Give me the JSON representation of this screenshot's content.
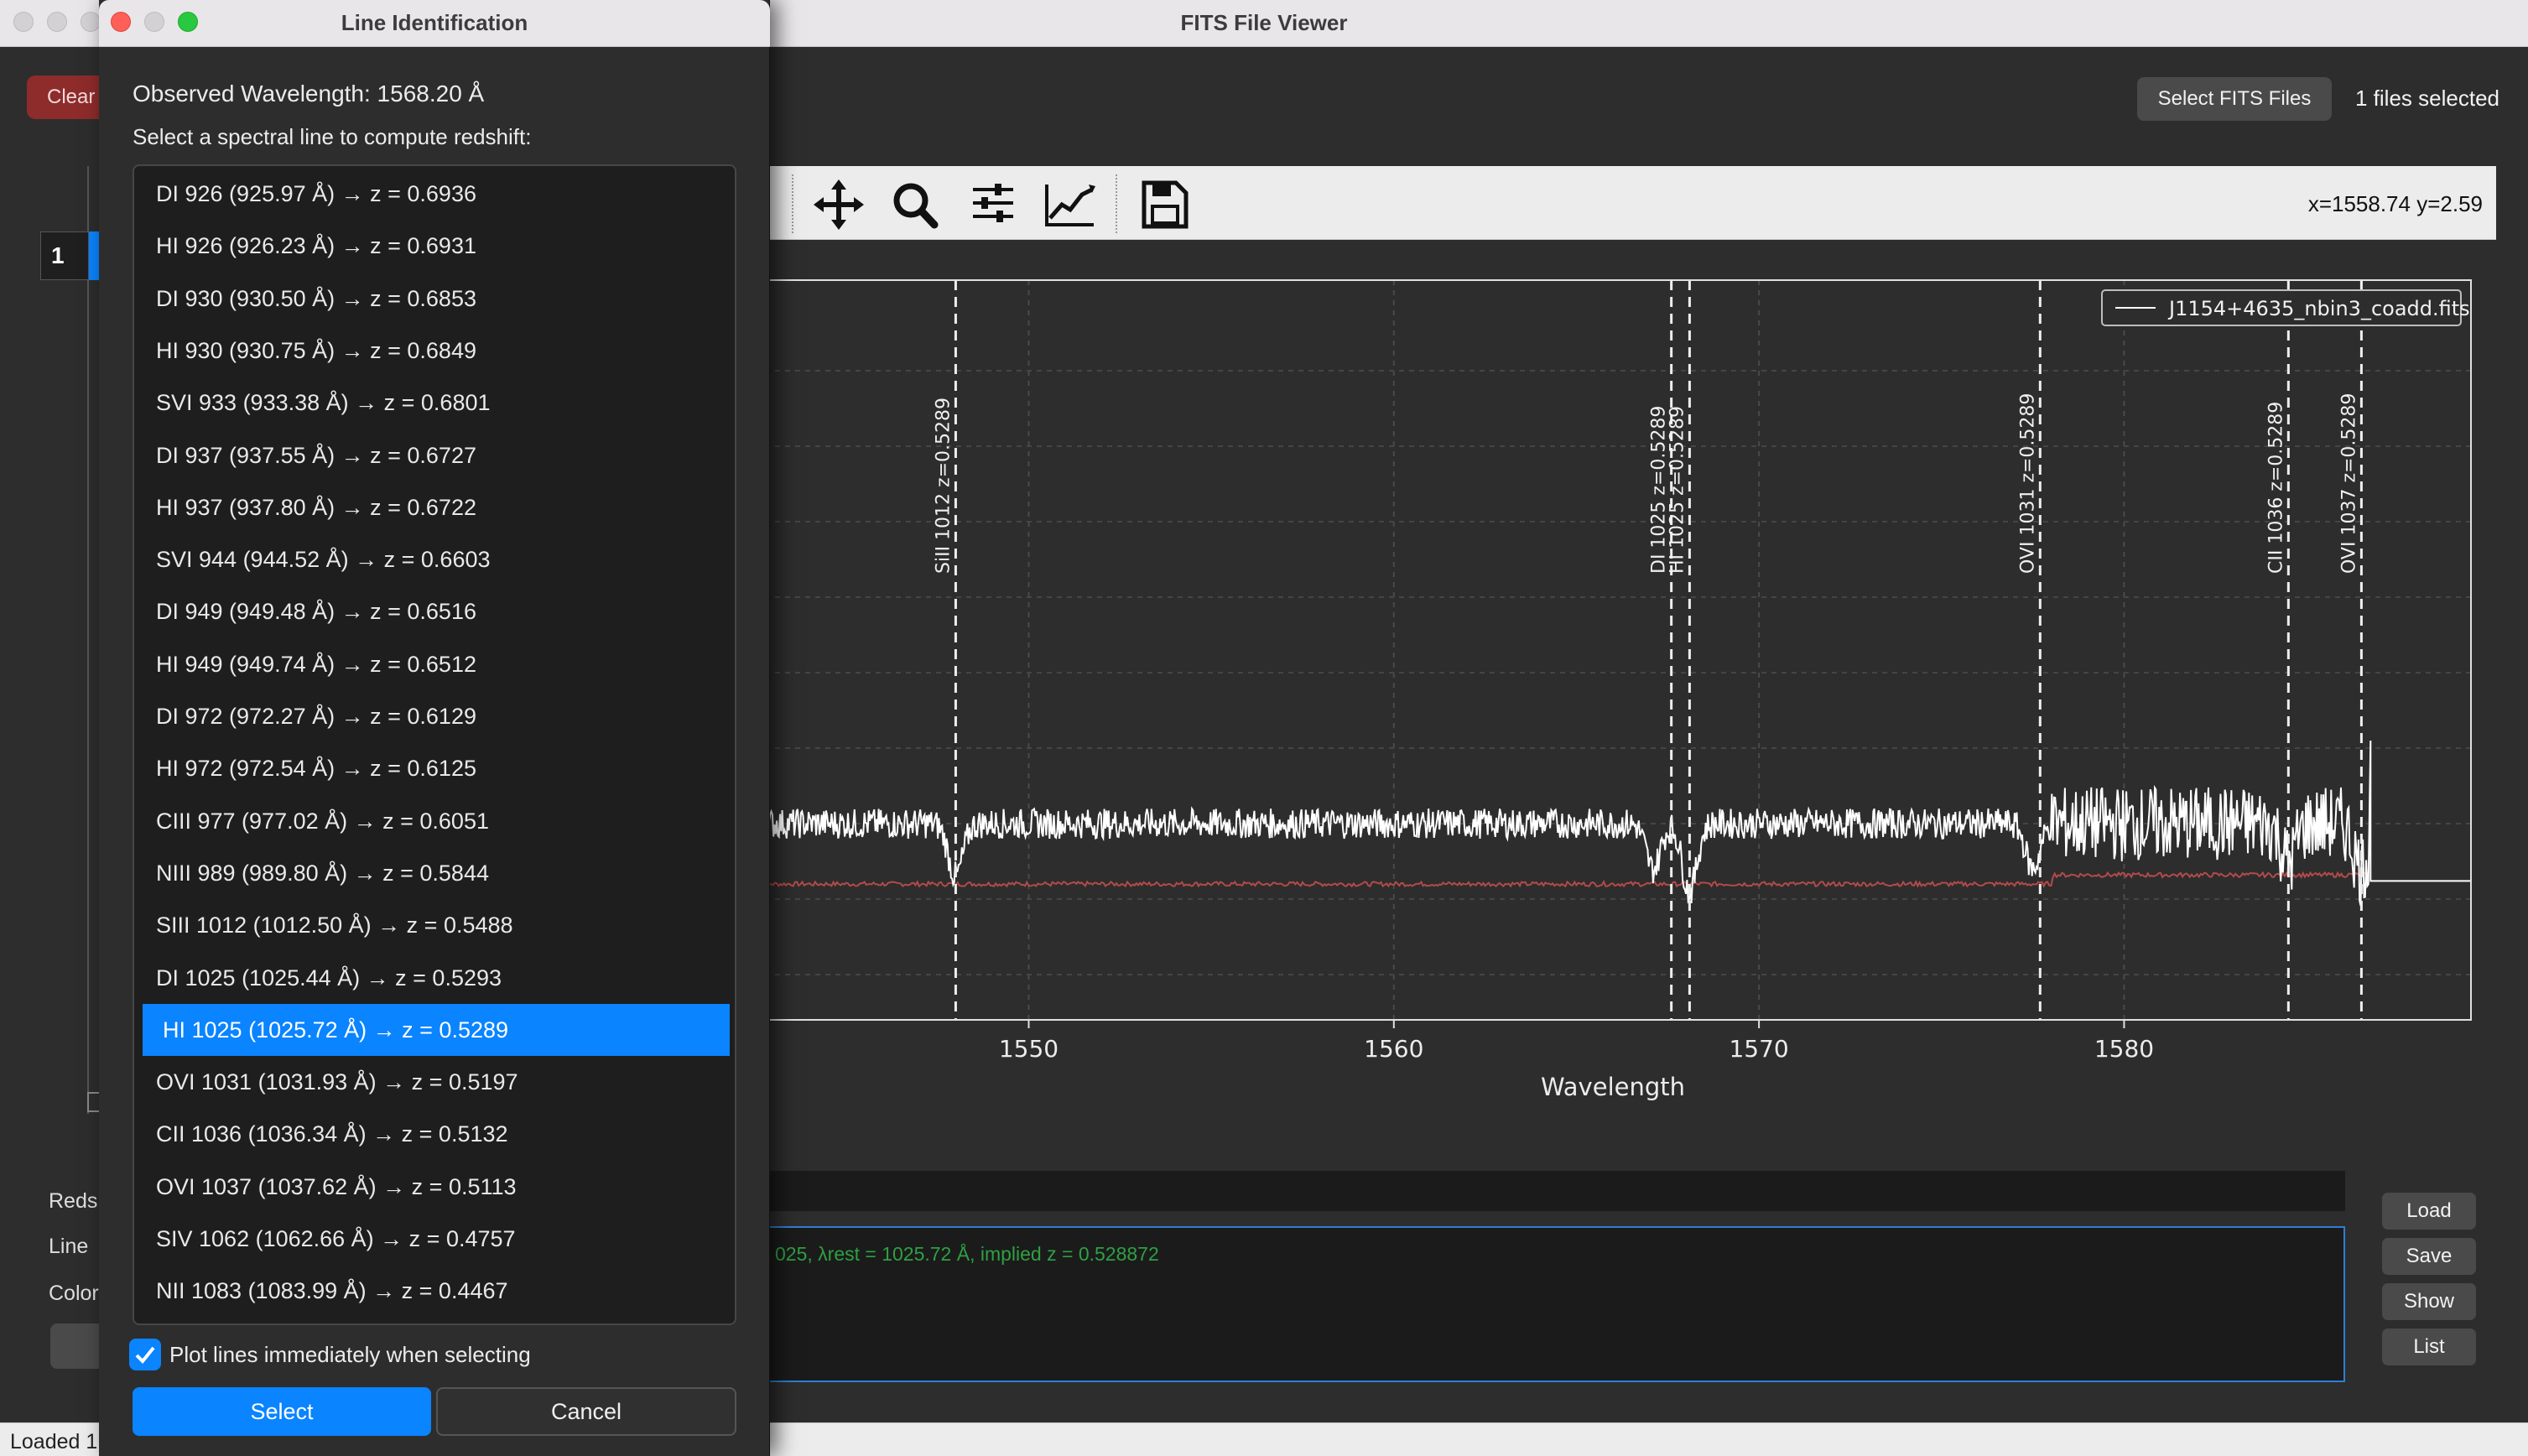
{
  "window": {
    "title": "FITS File Viewer",
    "clear_label": "Clear",
    "select_files_label": "Select FITS Files",
    "files_selected": "1 files selected",
    "row_index": "1",
    "left_labels": [
      "Reds",
      "Line",
      "Color"
    ],
    "status_text": "Loaded 1"
  },
  "toolbar": {
    "icons": [
      "pan-icon",
      "zoom-icon",
      "configure-subplots-icon",
      "edit-axis-icon",
      "save-icon"
    ],
    "coord_readout": "x=1558.74 y=2.59"
  },
  "chart_data": {
    "type": "line",
    "xlabel": "Wavelength",
    "xlim": [
      1542.5,
      1589.5
    ],
    "ylim": [
      -0.3,
      4.6
    ],
    "xticks": [
      1550,
      1560,
      1570,
      1580
    ],
    "grid": true,
    "legend": {
      "position": "top-right",
      "entries": [
        "J1154+4635_nbin3_coadd.fits"
      ]
    },
    "series": [
      {
        "name": "J1154+4635_nbin3_coadd.fits",
        "color": "#ffffff",
        "style": "noisy flux near 1.0 with absorption dips",
        "step_end": {
          "x": 1589.5,
          "y": 0.62
        }
      },
      {
        "color": "#b34a4a",
        "style": "error spectrum near 0.6"
      }
    ],
    "absorption_features": [
      {
        "x": 1548.0,
        "depth": 0.35
      },
      {
        "x": 1567.1,
        "depth": 0.3
      },
      {
        "x": 1568.1,
        "depth": 0.45
      },
      {
        "x": 1577.5,
        "depth": 0.3
      },
      {
        "x": 1584.5,
        "depth": 0.25
      },
      {
        "x": 1586.5,
        "depth": 0.3
      }
    ],
    "marker_lines": [
      {
        "x": 1548.0,
        "label": "SiII 1012 z=0.5289"
      },
      {
        "x": 1567.6,
        "label": "DI 1025 z=0.5289"
      },
      {
        "x": 1568.1,
        "label": "HI 1025 z=0.5289"
      },
      {
        "x": 1577.7,
        "label": "OVI 1031 z=0.5289"
      },
      {
        "x": 1584.5,
        "label": "CII 1036 z=0.5289"
      },
      {
        "x": 1586.5,
        "label": "OVI 1037 z=0.5289"
      }
    ]
  },
  "console": {
    "message": "025, λrest = 1025.72 Å, implied z = 0.528872",
    "buttons": [
      "Load",
      "Save",
      "Show",
      "List"
    ]
  },
  "dialog": {
    "title": "Line Identification",
    "observed": "Observed Wavelength: 1568.20 Å",
    "prompt": "Select a spectral line to compute redshift:",
    "items": [
      "DI 926 (925.97 Å) → z = 0.6936",
      "HI 926 (926.23 Å) → z = 0.6931",
      "DI 930 (930.50 Å) → z = 0.6853",
      "HI 930 (930.75 Å) → z = 0.6849",
      "SVI 933 (933.38 Å) → z = 0.6801",
      "DI 937 (937.55 Å) → z = 0.6727",
      "HI 937 (937.80 Å) → z = 0.6722",
      "SVI 944 (944.52 Å) → z = 0.6603",
      "DI 949 (949.48 Å) → z = 0.6516",
      "HI 949 (949.74 Å) → z = 0.6512",
      "DI 972 (972.27 Å) → z = 0.6129",
      "HI 972 (972.54 Å) → z = 0.6125",
      "CIII 977 (977.02 Å) → z = 0.6051",
      "NIII 989 (989.80 Å) → z = 0.5844",
      "SIII 1012 (1012.50 Å) → z = 0.5488",
      "DI 1025 (1025.44 Å) → z = 0.5293",
      "HI 1025 (1025.72 Å) → z = 0.5289",
      "OVI 1031 (1031.93 Å) → z = 0.5197",
      "CII 1036 (1036.34 Å) → z = 0.5132",
      "OVI 1037 (1037.62 Å) → z = 0.5113",
      "SIV 1062 (1062.66 Å) → z = 0.4757",
      "NII 1083 (1083.99 Å) → z = 0.4467"
    ],
    "selected_index": 16,
    "checkbox_label": "Plot lines immediately when selecting",
    "checkbox_checked": true,
    "select_label": "Select",
    "cancel_label": "Cancel"
  },
  "colors": {
    "accent": "#0a84ff",
    "clear_button": "#8e2b2b",
    "console_text": "#2ea043",
    "error_line": "#b34a4a"
  }
}
